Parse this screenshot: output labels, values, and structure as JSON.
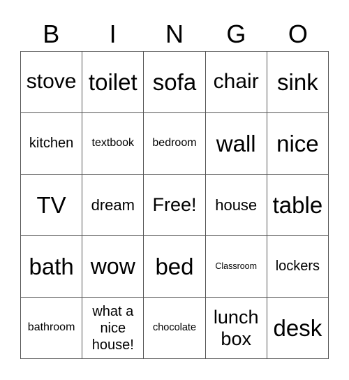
{
  "header": [
    "B",
    "I",
    "N",
    "G",
    "O"
  ],
  "cells": [
    [
      "stove",
      "toilet",
      "sofa",
      "chair",
      "sink"
    ],
    [
      "kitchen",
      "textbook",
      "bedroom",
      "wall",
      "nice"
    ],
    [
      "TV",
      "dream",
      "Free!",
      "house",
      "table"
    ],
    [
      "bath",
      "wow",
      "bed",
      "Classroom",
      "lockers"
    ],
    [
      "bathroom",
      "what a nice house!",
      "chocolate",
      "lunch box",
      "desk"
    ]
  ],
  "colors": {
    "grid_line": "#555555",
    "text": "#000000",
    "background": "#ffffff"
  }
}
